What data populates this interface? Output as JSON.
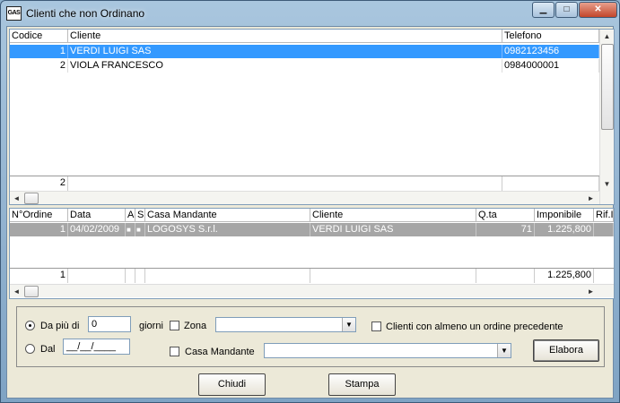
{
  "window": {
    "title": "Clienti che non Ordinano",
    "app_icon": "GAS"
  },
  "caption_buttons": {
    "minimize": "▁",
    "maximize": "□",
    "close": "✕"
  },
  "clients_grid": {
    "columns": [
      "Codice",
      "Cliente",
      "Telefono"
    ],
    "rows": [
      {
        "codice": "1",
        "cliente": "VERDI LUIGI SAS",
        "telefono": "0982123456"
      },
      {
        "codice": "2",
        "cliente": "VIOLA FRANCESCO",
        "telefono": "0984000001"
      }
    ],
    "footer_count": "2"
  },
  "orders_grid": {
    "columns": [
      "N°Ordine",
      "Data",
      "A",
      "S",
      "Casa Mandante",
      "Cliente",
      "Q.ta",
      "Imponibile",
      "Rif.I"
    ],
    "rows": [
      {
        "n_ordine": "1",
        "data": "04/02/2009",
        "a": "■",
        "s": "■",
        "casa_mandante": "LOGOSYS S.r.l.",
        "cliente": "VERDI LUIGI SAS",
        "qta": "71",
        "imponibile": "1.225,800",
        "rif": ""
      }
    ],
    "footer_count": "1",
    "footer_imponibile": "1.225,800"
  },
  "filters": {
    "da_piu_di_label": "Da più di",
    "giorni_value": "0",
    "giorni_label": "giorni",
    "dal_label": "Dal",
    "dal_value": "__/__/____",
    "zona_label": "Zona",
    "zona_value": "",
    "casa_mandante_label": "Casa Mandante",
    "casa_mandante_value": "",
    "almeno_ordine_label": "Clienti con almeno un ordine precedente",
    "elabora_label": "Elabora"
  },
  "buttons": {
    "chiudi": "Chiudi",
    "stampa": "Stampa"
  },
  "icons": {
    "arrow_up": "▲",
    "arrow_down": "▼",
    "arrow_left": "◄",
    "arrow_right": "►",
    "combo_drop": "▼"
  }
}
